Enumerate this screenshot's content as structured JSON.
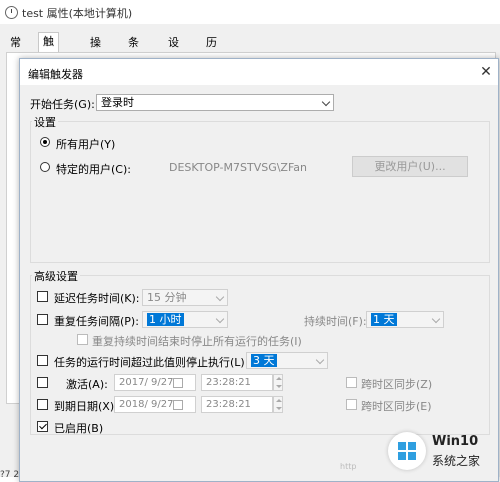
{
  "outer_window": {
    "title": "test 属性(本地计算机)",
    "tabs": [
      "常规",
      "触发器",
      "操作",
      "条件",
      "设置",
      "历史记录(已禁用)"
    ],
    "active_tab": "触发器",
    "bottom_fragment": "?7 2?"
  },
  "dialog": {
    "title": "编辑触发器",
    "start_task_label": "开始任务(G):",
    "start_task_value": "登录时",
    "settings_group": "设置",
    "all_users_label": "所有用户(Y)",
    "specific_user_label": "特定的用户(C):",
    "user_name": "DESKTOP-M7STVSG\\ZFan",
    "change_user_button": "更改用户(U)...",
    "advanced_group": "高级设置",
    "delay_label": "延迟任务时间(K):",
    "delay_value": "15 分钟",
    "repeat_label": "重复任务间隔(P):",
    "repeat_value": "1 小时",
    "duration_label": "持续时间(F):",
    "duration_value": "1 天",
    "stop_all_label": "重复持续时间结束时停止所有运行的任务(I)",
    "stop_if_longer_label": "任务的运行时间超过此值则停止执行(L):",
    "stop_if_longer_value": "3 天",
    "activate_label": "激活(A):",
    "activate_date": "2017/ 9/27",
    "activate_time": "23:28:21",
    "activate_sync": "跨时区同步(Z)",
    "expire_label": "到期日期(X):",
    "expire_date": "2018/ 9/27",
    "expire_time": "23:28:21",
    "expire_sync": "跨时区同步(E)",
    "enabled_label": "已启用(B)"
  },
  "watermark": {
    "brand": "Win10",
    "subtitle": "系统之家",
    "faint": "http"
  },
  "colors": {
    "selection": "#0078d7",
    "logo": "#2f9fe0"
  }
}
